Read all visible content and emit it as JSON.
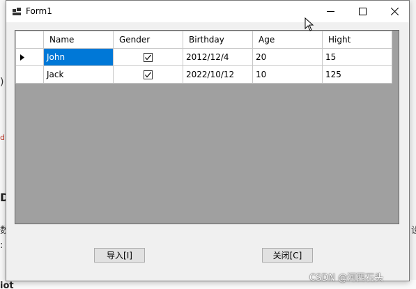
{
  "window": {
    "title": "Form1"
  },
  "grid": {
    "columns": [
      "Name",
      "Gender",
      "Birthday",
      "Age",
      "Hight"
    ],
    "rows": [
      {
        "name": "John",
        "gender_checked": true,
        "birthday": "2012/12/4",
        "age": "20",
        "hight": "15"
      },
      {
        "name": "Jack",
        "gender_checked": true,
        "birthday": "2022/10/12",
        "age": "10",
        "hight": "125"
      }
    ],
    "current_row": 0,
    "selected_cell": "name"
  },
  "buttons": {
    "import_label": "导入[I]",
    "close_label": "关闭[C]"
  },
  "background": {
    "fragments": [
      ")",
      "d",
      "D",
      "数",
      ":",
      "iot",
      "设"
    ]
  },
  "watermark": "CSDN @河西石头",
  "colors": {
    "selection": "#0078d7",
    "grid_background": "#a0a0a0",
    "window_background": "#f0f0f0"
  }
}
